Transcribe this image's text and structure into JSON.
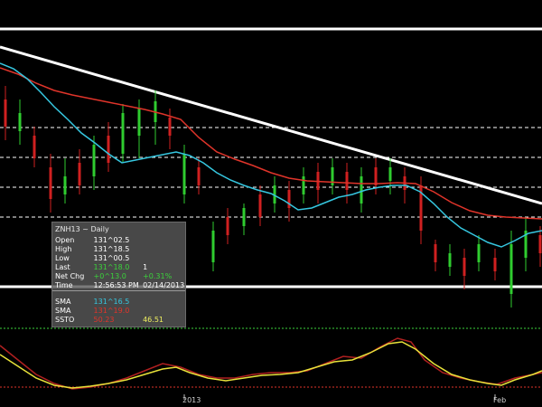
{
  "chart_data": {
    "type": "candlestick",
    "instrument": "ZNH13",
    "period": "Daily",
    "x_ticks": [
      "2013",
      "Feb"
    ],
    "candles_note": "",
    "price_ylim": [
      0,
      1
    ],
    "lines": {
      "sma_fast_color": "#36c7e0",
      "sma_slow_color": "#e0342a",
      "trendline_color": "#ffffff",
      "stoch_k_color": "#e8e23a",
      "stoch_d_color": "#b02020"
    }
  },
  "info": {
    "title": "ZNH13 ~ Daily",
    "rows": [
      {
        "label": "Open",
        "value": "131^02.5",
        "color": "#ffffff"
      },
      {
        "label": "High",
        "value": "131^18.5",
        "color": "#ffffff"
      },
      {
        "label": "Low",
        "value": "131^00.5",
        "color": "#ffffff"
      },
      {
        "label": "Last",
        "value": "131^18.0",
        "extra": "1",
        "color": "#3bd23b"
      },
      {
        "label": "Net Chg",
        "value": "+0^13.0",
        "extra": "+0.31%",
        "color": "#3bd23b"
      },
      {
        "label": "Time",
        "value": "12:56:53 PM",
        "extra": "02/14/2013",
        "color": "#ffffff"
      }
    ],
    "indicators": [
      {
        "label": "SMA",
        "value": "131^16.5",
        "color": "#36c7e0"
      },
      {
        "label": "SMA",
        "value": "131^19.0",
        "color": "#e0342a"
      },
      {
        "label": "SSTO",
        "value": "50.23",
        "extra": "46.51",
        "color": "#e0342a",
        "extra_color": "#f0f060"
      }
    ]
  }
}
